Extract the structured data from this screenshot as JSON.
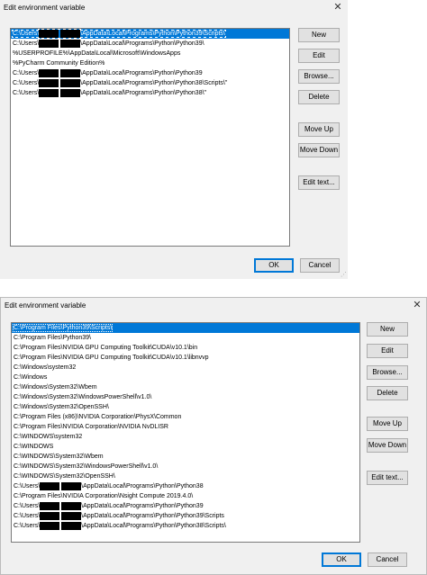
{
  "dialog1": {
    "title": "Edit environment variable",
    "rows": [
      {
        "pre": "C:\\Users\\",
        "post": "\\AppData\\Local\\Programs\\Python\\Python39\\Scripts\\",
        "redacted": true,
        "selected": true
      },
      {
        "pre": "C:\\Users\\",
        "post": "\\AppData\\Local\\Programs\\Python\\Python39\\",
        "redacted": true
      },
      {
        "pre": "%USERPROFILE%\\AppData\\Local\\Microsoft\\WindowsApps",
        "post": "",
        "redacted": false
      },
      {
        "pre": "%PyCharm Community Edition%",
        "post": "",
        "redacted": false
      },
      {
        "pre": "C:\\Users\\",
        "post": "\\AppData\\Local\\Programs\\Python\\Python39",
        "redacted": true
      },
      {
        "pre": "C:\\Users\\",
        "post": "\\AppData\\Local\\Programs\\Python\\Python38\\Scripts\\\"",
        "redacted": true
      },
      {
        "pre": "C:\\Users\\",
        "post": "\\AppData\\Local\\Programs\\Python\\Python38\\\"",
        "redacted": true
      }
    ],
    "buttons": {
      "new": "New",
      "edit": "Edit",
      "browse": "Browse...",
      "delete": "Delete",
      "move_up": "Move Up",
      "move_down": "Move Down",
      "edit_text": "Edit text...",
      "ok": "OK",
      "cancel": "Cancel"
    }
  },
  "dialog2": {
    "title": "Edit environment variable",
    "rows": [
      {
        "pre": "C:\\Program Files\\Python39\\Scripts\\",
        "post": "",
        "redacted": false,
        "selected": true
      },
      {
        "pre": "C:\\Program Files\\Python39\\",
        "post": "",
        "redacted": false
      },
      {
        "pre": "C:\\Program Files\\NVIDIA GPU Computing Toolkit\\CUDA\\v10.1\\bin",
        "post": "",
        "redacted": false
      },
      {
        "pre": "C:\\Program Files\\NVIDIA GPU Computing Toolkit\\CUDA\\v10.1\\libnvvp",
        "post": "",
        "redacted": false
      },
      {
        "pre": "C:\\Windows\\system32",
        "post": "",
        "redacted": false
      },
      {
        "pre": "C:\\Windows",
        "post": "",
        "redacted": false
      },
      {
        "pre": "C:\\Windows\\System32\\Wbem",
        "post": "",
        "redacted": false
      },
      {
        "pre": "C:\\Windows\\System32\\WindowsPowerShell\\v1.0\\",
        "post": "",
        "redacted": false
      },
      {
        "pre": "C:\\Windows\\System32\\OpenSSH\\",
        "post": "",
        "redacted": false
      },
      {
        "pre": "C:\\Program Files (x86)\\NVIDIA Corporation\\PhysX\\Common",
        "post": "",
        "redacted": false
      },
      {
        "pre": "C:\\Program Files\\NVIDIA Corporation\\NVIDIA NvDLISR",
        "post": "",
        "redacted": false
      },
      {
        "pre": "C:\\WINDOWS\\system32",
        "post": "",
        "redacted": false
      },
      {
        "pre": "C:\\WINDOWS",
        "post": "",
        "redacted": false
      },
      {
        "pre": "C:\\WINDOWS\\System32\\Wbem",
        "post": "",
        "redacted": false
      },
      {
        "pre": "C:\\WINDOWS\\System32\\WindowsPowerShell\\v1.0\\",
        "post": "",
        "redacted": false
      },
      {
        "pre": "C:\\WINDOWS\\System32\\OpenSSH\\",
        "post": "",
        "redacted": false
      },
      {
        "pre": "C:\\Users\\",
        "post": "\\AppData\\Local\\Programs\\Python\\Python38",
        "redacted": true
      },
      {
        "pre": "C:\\Program Files\\NVIDIA Corporation\\Nsight Compute 2019.4.0\\",
        "post": "",
        "redacted": false
      },
      {
        "pre": "C:\\Users\\",
        "post": "\\AppData\\Local\\Programs\\Python\\Python39",
        "redacted": true
      },
      {
        "pre": "C:\\Users\\",
        "post": "\\AppData\\Local\\Programs\\Python\\Python39\\Scripts",
        "redacted": true
      },
      {
        "pre": "C:\\Users\\",
        "post": "\\AppData\\Local\\Programs\\Python\\Python38\\Scripts\\",
        "redacted": true
      }
    ],
    "buttons": {
      "new": "New",
      "edit": "Edit",
      "browse": "Browse...",
      "delete": "Delete",
      "move_up": "Move Up",
      "move_down": "Move Down",
      "edit_text": "Edit text...",
      "ok": "OK",
      "cancel": "Cancel"
    }
  },
  "colors": {
    "selection": "#0078d7",
    "dialog_bg": "#f0f0f0",
    "button_bg": "#e1e1e1"
  },
  "icons": {
    "close": "close-icon",
    "resize": "resize-grip-icon"
  }
}
